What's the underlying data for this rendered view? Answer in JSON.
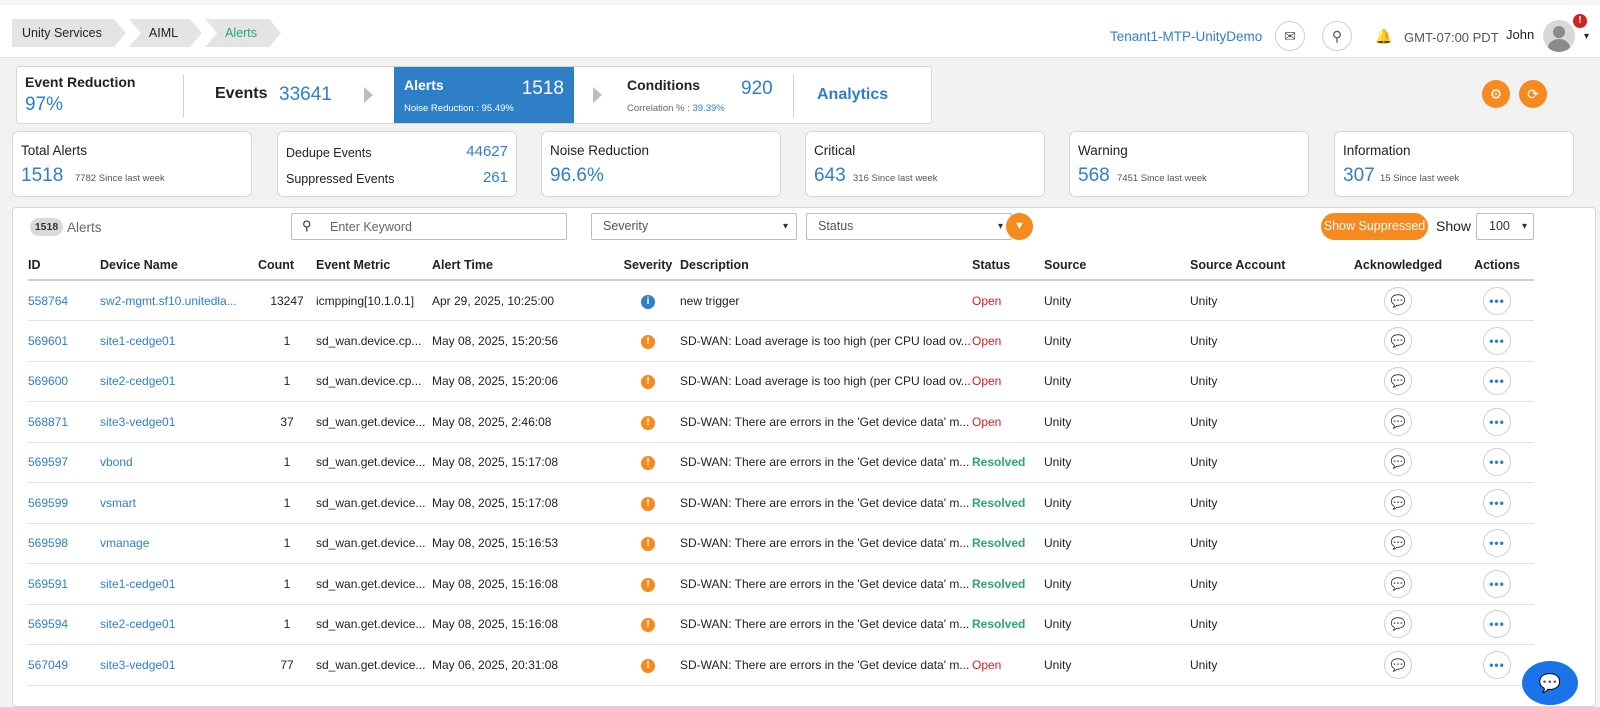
{
  "breadcrumb": [
    "Unity Services",
    "AIML",
    "Alerts"
  ],
  "header": {
    "tenant": "Tenant1-MTP-UnityDemo",
    "timezone": "GMT-07:00 PDT",
    "user": "John",
    "notification_badge": "!"
  },
  "funnel": {
    "event_reduction_label": "Event Reduction",
    "event_reduction_value": "97%",
    "events_label": "Events",
    "events_value": "33641",
    "alerts_label": "Alerts",
    "alerts_value": "1518",
    "noise_reduction_text": "Noise Reduction : 95.49%",
    "conditions_label": "Conditions",
    "conditions_value": "920",
    "correlation_label": "Correlation % :",
    "correlation_value": "39.39%",
    "analytics_label": "Analytics"
  },
  "cards": {
    "total": {
      "title": "Total Alerts",
      "value": "1518",
      "since": "7782 Since last week"
    },
    "dedupe": {
      "dedupe_label": "Dedupe Events",
      "dedupe_value": "44627",
      "suppressed_label": "Suppressed Events",
      "suppressed_value": "261"
    },
    "noise": {
      "title": "Noise Reduction",
      "value": "96.6%"
    },
    "critical": {
      "title": "Critical",
      "value": "643",
      "since": "316 Since last week"
    },
    "warning": {
      "title": "Warning",
      "value": "568",
      "since": "7451 Since last week"
    },
    "information": {
      "title": "Information",
      "value": "307",
      "since": "15 Since last week"
    }
  },
  "toolbar": {
    "count": "1518",
    "alerts_label": "Alerts",
    "search_placeholder": "Enter Keyword",
    "severity_label": "Severity",
    "status_label": "Status",
    "show_suppressed_label": "Show Suppressed",
    "show_label": "Show",
    "show_value": "100"
  },
  "columns": [
    "ID",
    "Device Name",
    "Count",
    "Event Metric",
    "Alert Time",
    "Severity",
    "Description",
    "Status",
    "Source",
    "Source Account",
    "Acknowledged",
    "Actions"
  ],
  "rows": [
    {
      "id": "558764",
      "device": "sw2-mgmt.sf10.unitedla...",
      "count": "13247",
      "metric": "icmpping[10.1.0.1]",
      "time": "Apr 29, 2025, 10:25:00",
      "severity": "info",
      "description": "new trigger",
      "status": "Open",
      "source": "Unity",
      "account": "Unity"
    },
    {
      "id": "569601",
      "device": "site1-cedge01",
      "count": "1",
      "metric": "sd_wan.device.cp...",
      "time": "May 08, 2025, 15:20:56",
      "severity": "warning",
      "description": "SD-WAN: Load average is too high (per CPU load ov...",
      "status": "Open",
      "source": "Unity",
      "account": "Unity"
    },
    {
      "id": "569600",
      "device": "site2-cedge01",
      "count": "1",
      "metric": "sd_wan.device.cp...",
      "time": "May 08, 2025, 15:20:06",
      "severity": "warning",
      "description": "SD-WAN: Load average is too high (per CPU load ov...",
      "status": "Open",
      "source": "Unity",
      "account": "Unity"
    },
    {
      "id": "568871",
      "device": "site3-vedge01",
      "count": "37",
      "metric": "sd_wan.get.device...",
      "time": "May 08, 2025, 2:46:08",
      "severity": "warning",
      "description": "SD-WAN: There are errors in the 'Get device data' m...",
      "status": "Open",
      "source": "Unity",
      "account": "Unity"
    },
    {
      "id": "569597",
      "device": "vbond",
      "count": "1",
      "metric": "sd_wan.get.device...",
      "time": "May 08, 2025, 15:17:08",
      "severity": "warning",
      "description": "SD-WAN: There are errors in the 'Get device data' m...",
      "status": "Resolved",
      "source": "Unity",
      "account": "Unity"
    },
    {
      "id": "569599",
      "device": "vsmart",
      "count": "1",
      "metric": "sd_wan.get.device...",
      "time": "May 08, 2025, 15:17:08",
      "severity": "warning",
      "description": "SD-WAN: There are errors in the 'Get device data' m...",
      "status": "Resolved",
      "source": "Unity",
      "account": "Unity"
    },
    {
      "id": "569598",
      "device": "vmanage",
      "count": "1",
      "metric": "sd_wan.get.device...",
      "time": "May 08, 2025, 15:16:53",
      "severity": "warning",
      "description": "SD-WAN: There are errors in the 'Get device data' m...",
      "status": "Resolved",
      "source": "Unity",
      "account": "Unity"
    },
    {
      "id": "569591",
      "device": "site1-cedge01",
      "count": "1",
      "metric": "sd_wan.get.device...",
      "time": "May 08, 2025, 15:16:08",
      "severity": "warning",
      "description": "SD-WAN: There are errors in the 'Get device data' m...",
      "status": "Resolved",
      "source": "Unity",
      "account": "Unity"
    },
    {
      "id": "569594",
      "device": "site2-cedge01",
      "count": "1",
      "metric": "sd_wan.get.device...",
      "time": "May 08, 2025, 15:16:08",
      "severity": "warning",
      "description": "SD-WAN: There are errors in the 'Get device data' m...",
      "status": "Resolved",
      "source": "Unity",
      "account": "Unity"
    },
    {
      "id": "567049",
      "device": "site3-vedge01",
      "count": "77",
      "metric": "sd_wan.get.device...",
      "time": "May 06, 2025, 20:31:08",
      "severity": "warning",
      "description": "SD-WAN: There are errors in the 'Get device data' m...",
      "status": "Open",
      "source": "Unity",
      "account": "Unity"
    }
  ],
  "colors": {
    "accent": "#2f7fc7",
    "orange": "#f58a1f",
    "open": "#d32020",
    "resolved": "#2aa86b"
  }
}
